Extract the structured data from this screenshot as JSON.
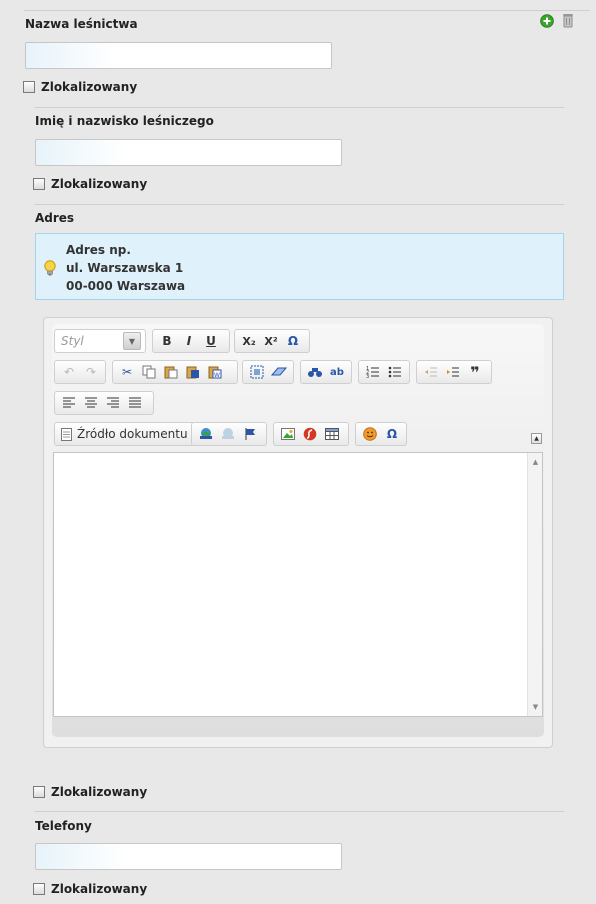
{
  "section1": {
    "label": "Nazwa leśnictwa",
    "value": "",
    "localized_label": "Zlokalizowany",
    "add_icon": "plus-circle-icon",
    "delete_icon": "trash-icon"
  },
  "section2": {
    "label": "Imię i nazwisko leśniczego",
    "value": "",
    "localized_label": "Zlokalizowany"
  },
  "section3": {
    "label": "Adres",
    "hint_lines": [
      "Adres np.",
      "ul. Warszawska 1",
      "00-000 Warszawa"
    ],
    "hint_icon": "lightbulb-icon",
    "localized_label": "Zlokalizowany"
  },
  "editor": {
    "style_placeholder": "Styl",
    "format_buttons": [
      "B",
      "I",
      "U"
    ],
    "script_buttons": [
      "X₂",
      "X²",
      "Ω"
    ],
    "source_label": "Źródło dokumentu",
    "content": ""
  },
  "section4": {
    "label": "Telefony",
    "value": "",
    "localized_label": "Zlokalizowany"
  },
  "colors": {
    "background": "#e8e8e8",
    "hint_background": "#dff1fb",
    "hint_border": "#a5d3ec",
    "add_green": "#3aa52c"
  }
}
